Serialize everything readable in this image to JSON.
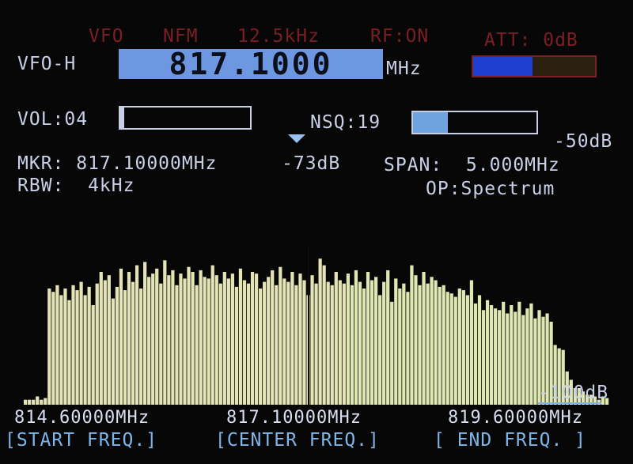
{
  "status": {
    "vfo": "VFO",
    "mode": "NFM",
    "step": "12.5kHz",
    "rf": "RF:ON",
    "att": "ATT: 0dB"
  },
  "vfo_row": {
    "label": "VFO-H",
    "frequency": "817.1000",
    "unit": "MHz",
    "signal_level": 0.49,
    "signal_color": "#1f3fd0",
    "signal_rest_color": "#2b2010"
  },
  "vol": {
    "label": "VOL:04",
    "level": 0.03
  },
  "nsq": {
    "label": "NSQ:19",
    "level": 0.28,
    "fill_color": "#6fa3e0"
  },
  "ref_level": "-50dB",
  "marker": {
    "freq_label": "MKR: 817.10000MHz",
    "level_label": "-73dB",
    "span_label": "SPAN:  5.000MHz"
  },
  "rbw": {
    "label": "RBW:  4kHz"
  },
  "op": {
    "label": "OP:Spectrum"
  },
  "spectrum": {
    "floor_label": "-100dB",
    "bar_color": "#e4e4b6",
    "bar_color_right": "#dfe7b2",
    "center_line_color": "#0d0d0d",
    "levels": [
      0.03,
      0.03,
      0.03,
      0.05,
      0.03,
      0.04,
      0.7,
      0.68,
      0.72,
      0.66,
      0.7,
      0.63,
      0.72,
      0.69,
      0.74,
      0.66,
      0.71,
      0.6,
      0.73,
      0.8,
      0.75,
      0.78,
      0.64,
      0.71,
      0.82,
      0.69,
      0.8,
      0.74,
      0.84,
      0.7,
      0.86,
      0.77,
      0.79,
      0.82,
      0.73,
      0.87,
      0.78,
      0.81,
      0.72,
      0.79,
      0.76,
      0.83,
      0.8,
      0.72,
      0.81,
      0.77,
      0.76,
      0.84,
      0.78,
      0.73,
      0.8,
      0.76,
      0.79,
      0.71,
      0.82,
      0.75,
      0.73,
      0.8,
      0.79,
      0.7,
      0.74,
      0.77,
      0.81,
      0.72,
      0.83,
      0.76,
      0.74,
      0.8,
      0.72,
      0.79,
      0.75,
      0.66,
      0.78,
      0.73,
      0.88,
      0.84,
      0.74,
      0.72,
      0.8,
      0.75,
      0.73,
      0.79,
      0.72,
      0.81,
      0.74,
      0.7,
      0.8,
      0.75,
      0.77,
      0.66,
      0.74,
      0.81,
      0.62,
      0.76,
      0.7,
      0.73,
      0.68,
      0.84,
      0.78,
      0.72,
      0.8,
      0.73,
      0.77,
      0.75,
      0.71,
      0.72,
      0.68,
      0.67,
      0.65,
      0.7,
      0.69,
      0.66,
      0.75,
      0.61,
      0.66,
      0.57,
      0.63,
      0.6,
      0.58,
      0.57,
      0.62,
      0.55,
      0.6,
      0.56,
      0.62,
      0.54,
      0.58,
      0.61,
      0.52,
      0.57,
      0.53,
      0.55,
      0.5,
      0.36,
      0.34,
      0.33,
      0.2,
      0.15,
      0.1,
      0.1,
      0.08,
      0.06,
      0.06,
      0.05,
      0.03,
      0.05,
      0.04
    ]
  },
  "freq_axis": {
    "start": "814.60000MHz",
    "center": "817.10000MHz",
    "end": "819.60000MHz"
  },
  "softkeys": {
    "start": "[START FREQ.]",
    "center": "[CENTER FREQ.]",
    "end": "[ END FREQ. ]"
  }
}
